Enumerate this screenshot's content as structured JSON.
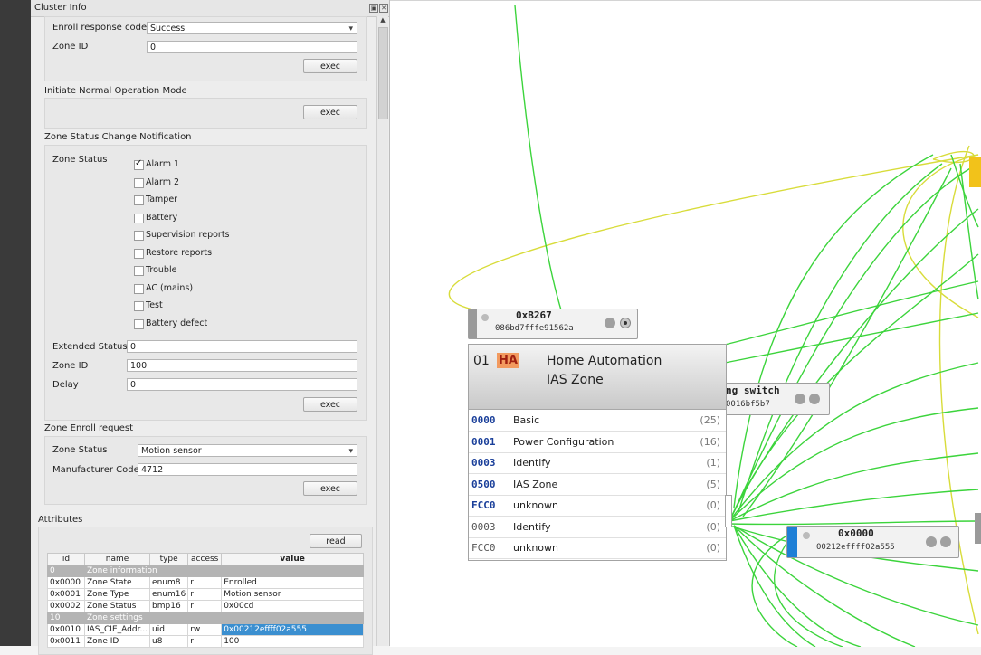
{
  "panel": {
    "title": "Cluster Info",
    "enroll_response": {
      "label": "Enroll response code",
      "value": "Success"
    },
    "zone_id_top": {
      "label": "Zone ID",
      "value": "0"
    },
    "exec_label": "exec",
    "initiate_normal": {
      "title": "Initiate Normal Operation Mode"
    },
    "zone_status_change": {
      "title": "Zone Status Change Notification",
      "zone_status_label": "Zone Status",
      "options": [
        {
          "label": "Alarm 1",
          "checked": true
        },
        {
          "label": "Alarm 2",
          "checked": false
        },
        {
          "label": "Tamper",
          "checked": false
        },
        {
          "label": "Battery",
          "checked": false
        },
        {
          "label": "Supervision reports",
          "checked": false
        },
        {
          "label": "Restore reports",
          "checked": false
        },
        {
          "label": "Trouble",
          "checked": false
        },
        {
          "label": "AC (mains)",
          "checked": false
        },
        {
          "label": "Test",
          "checked": false
        },
        {
          "label": "Battery defect",
          "checked": false
        }
      ],
      "extended_status": {
        "label": "Extended Status",
        "value": "0"
      },
      "zone_id": {
        "label": "Zone ID",
        "value": "100"
      },
      "delay": {
        "label": "Delay",
        "value": "0"
      }
    },
    "zone_enroll": {
      "title": "Zone Enroll request",
      "zone_status": {
        "label": "Zone Status",
        "value": "Motion sensor"
      },
      "manufacturer": {
        "label": "Manufacturer Code",
        "value": "4712"
      }
    },
    "attributes": {
      "title": "Attributes",
      "read_label": "read",
      "columns": [
        "id",
        "name",
        "type",
        "access",
        "value"
      ],
      "sections": [
        {
          "id": "0",
          "name": "Zone information"
        },
        {
          "id": "10",
          "name": "Zone settings"
        }
      ],
      "rows": [
        {
          "id": "0x0000",
          "name": "Zone State",
          "type": "enum8",
          "access": "r",
          "value": "Enrolled"
        },
        {
          "id": "0x0001",
          "name": "Zone Type",
          "type": "enum16",
          "access": "r",
          "value": "Motion sensor"
        },
        {
          "id": "0x0002",
          "name": "Zone Status",
          "type": "bmp16",
          "access": "r",
          "value": "0x00cd"
        },
        {
          "id": "0x0010",
          "name": "IAS_CIE_Addr...",
          "type": "uid",
          "access": "rw",
          "value": "0x00212effff02a555"
        },
        {
          "id": "0x0011",
          "name": "Zone ID",
          "type": "u8",
          "access": "r",
          "value": "100"
        }
      ]
    }
  },
  "graph": {
    "node_b267": {
      "addr": "0xB267",
      "mac": "086bd7fffe91562a"
    },
    "node_switch": {
      "addr": "ng switch",
      "mac": "0016bf5b7"
    },
    "node_0000": {
      "addr": "0x0000",
      "mac": "00212effff02a555"
    },
    "cluster_panel": {
      "endpoint": "01",
      "badge": "HA",
      "profile": "Home Automation",
      "device": "IAS Zone",
      "clusters": [
        {
          "id": "0000",
          "name": "Basic",
          "count": "(25)",
          "server": true
        },
        {
          "id": "0001",
          "name": "Power Configuration",
          "count": "(16)",
          "server": true
        },
        {
          "id": "0003",
          "name": "Identify",
          "count": "(1)",
          "server": true
        },
        {
          "id": "0500",
          "name": "IAS Zone",
          "count": "(5)",
          "server": true
        },
        {
          "id": "FCC0",
          "name": "unknown",
          "count": "(0)",
          "server": true
        },
        {
          "id": "0003",
          "name": "Identify",
          "count": "(0)",
          "server": false
        },
        {
          "id": "FCC0",
          "name": "unknown",
          "count": "(0)",
          "server": false
        }
      ]
    }
  }
}
